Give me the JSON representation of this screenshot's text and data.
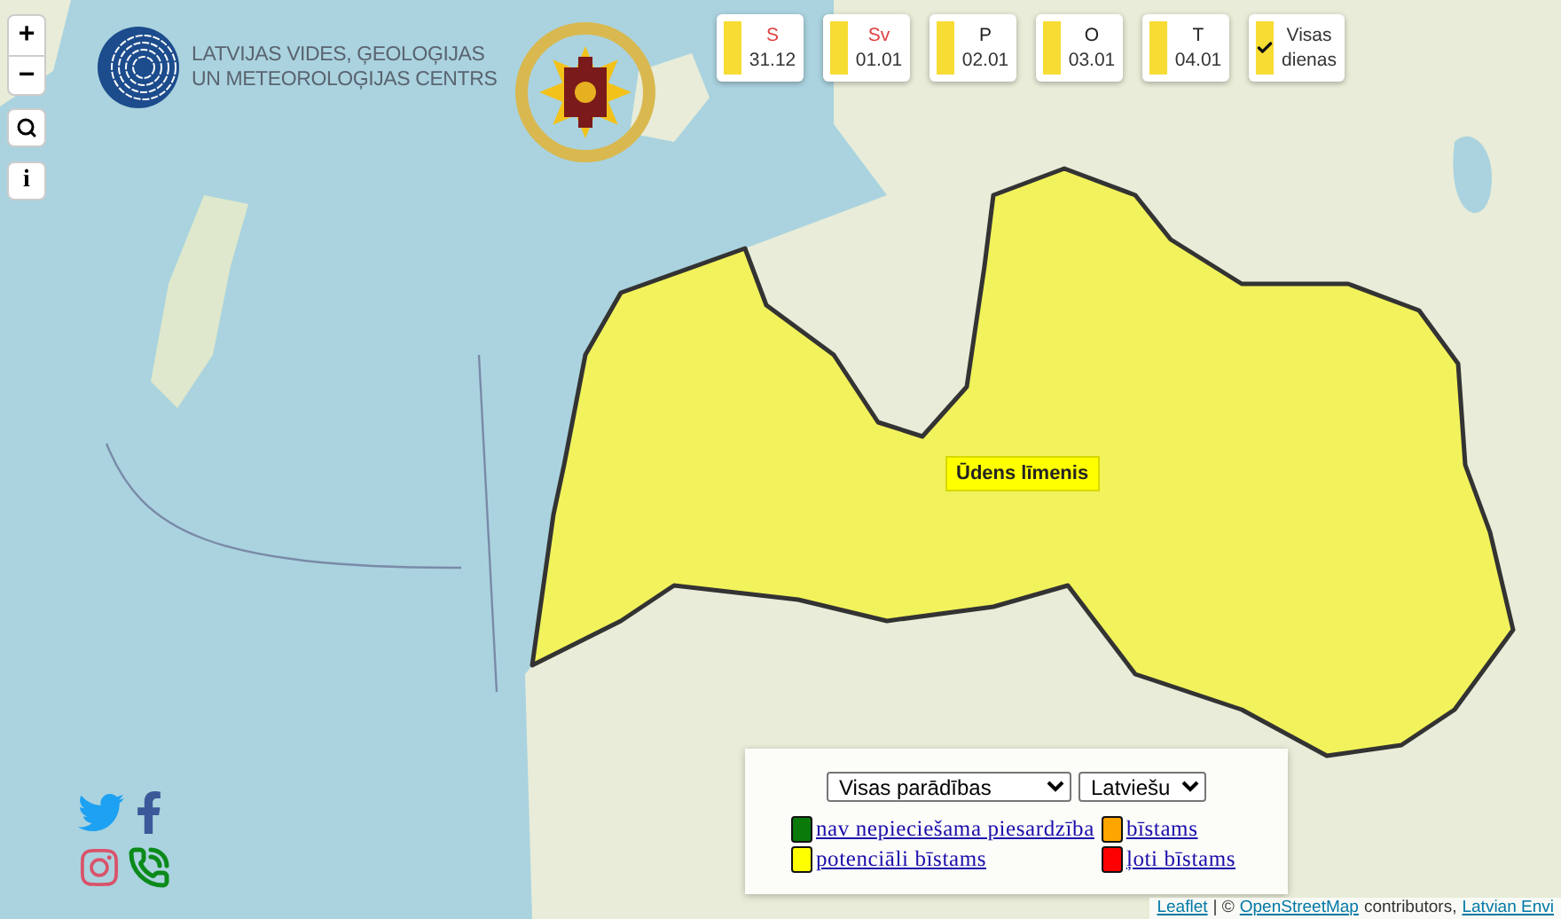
{
  "map_controls": {
    "zoom_in": "+",
    "zoom_out": "−",
    "info": "i"
  },
  "logo": {
    "line_1": "LATVIJAS VIDES, ĢEOLOĢIJAS",
    "line_2": "UN METEOROLOĢIJAS CENTRS"
  },
  "days": [
    {
      "day": "S",
      "date": "31.12",
      "weekend": true,
      "color": "#f7dc34"
    },
    {
      "day": "Sv",
      "date": "01.01",
      "weekend": true,
      "color": "#f7dc34"
    },
    {
      "day": "P",
      "date": "02.01",
      "weekend": false,
      "color": "#f7dc34"
    },
    {
      "day": "O",
      "date": "03.01",
      "weekend": false,
      "color": "#f7dc34"
    },
    {
      "day": "T",
      "date": "04.01",
      "weekend": false,
      "color": "#f7dc34"
    }
  ],
  "all_days": {
    "label": "Visas dienas",
    "checked": true,
    "color": "#f7dc34"
  },
  "warning_area": {
    "label": "Ūdens līmenis",
    "color": "#f2f25c"
  },
  "legend": {
    "phenomenon_select": "Visas parādības",
    "language_select": "Latviešu",
    "items": [
      {
        "label": "nav nepieciešama piesardzība",
        "color": "#0a7a0a"
      },
      {
        "label": "bīstams",
        "color": "#ffa500"
      },
      {
        "label": "potenciāli bīstams",
        "color": "#ffff00"
      },
      {
        "label": "ļoti bīstams",
        "color": "#ff0000"
      }
    ]
  },
  "attribution": [
    {
      "kind": "link",
      "text": "Leaflet"
    },
    {
      "kind": "text",
      "text": "| ©"
    },
    {
      "kind": "link",
      "text": "OpenStreetMap"
    },
    {
      "kind": "text",
      "text": "contributors,"
    },
    {
      "kind": "link",
      "text": "Latvian Envi"
    }
  ]
}
